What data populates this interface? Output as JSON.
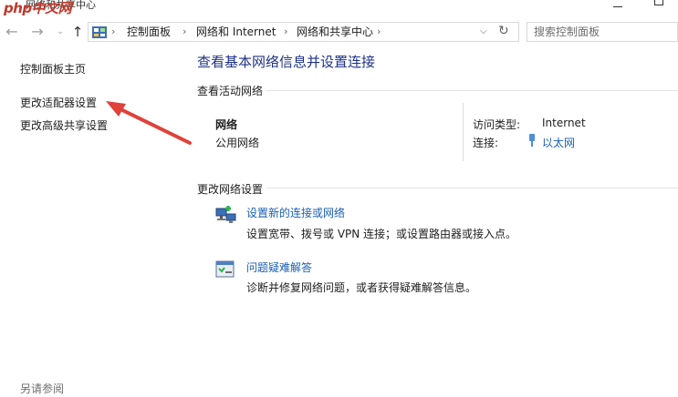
{
  "window": {
    "title": "网络和共享中心",
    "watermark": "php中文网"
  },
  "nav": {
    "breadcrumbs": [
      "控制面板",
      "网络和 Internet",
      "网络和共享中心"
    ],
    "search_placeholder": "搜索控制面板"
  },
  "sidebar": {
    "items": [
      "控制面板主页",
      "更改适配器设置",
      "更改高级共享设置"
    ],
    "see_also": "另请参阅"
  },
  "main": {
    "title": "查看基本网络信息并设置连接",
    "active_section": "查看活动网络",
    "network": {
      "name": "网络",
      "type": "公用网络"
    },
    "access_type_label": "访问类型:",
    "access_type_value": "Internet",
    "connections_label": "连接:",
    "connections_value": "以太网",
    "change_section": "更改网络设置",
    "tasks": [
      {
        "title": "设置新的连接或网络",
        "desc": "设置宽带、拨号或 VPN 连接；或设置路由器或接入点。",
        "icon": "network-setup-icon"
      },
      {
        "title": "问题疑难解答",
        "desc": "诊断并修复网络问题，或者获得疑难解答信息。",
        "icon": "troubleshoot-icon"
      }
    ]
  },
  "colors": {
    "title_blue": "#1e3287",
    "link_blue": "#1a5fb4",
    "annotation_red": "#e0413a"
  }
}
